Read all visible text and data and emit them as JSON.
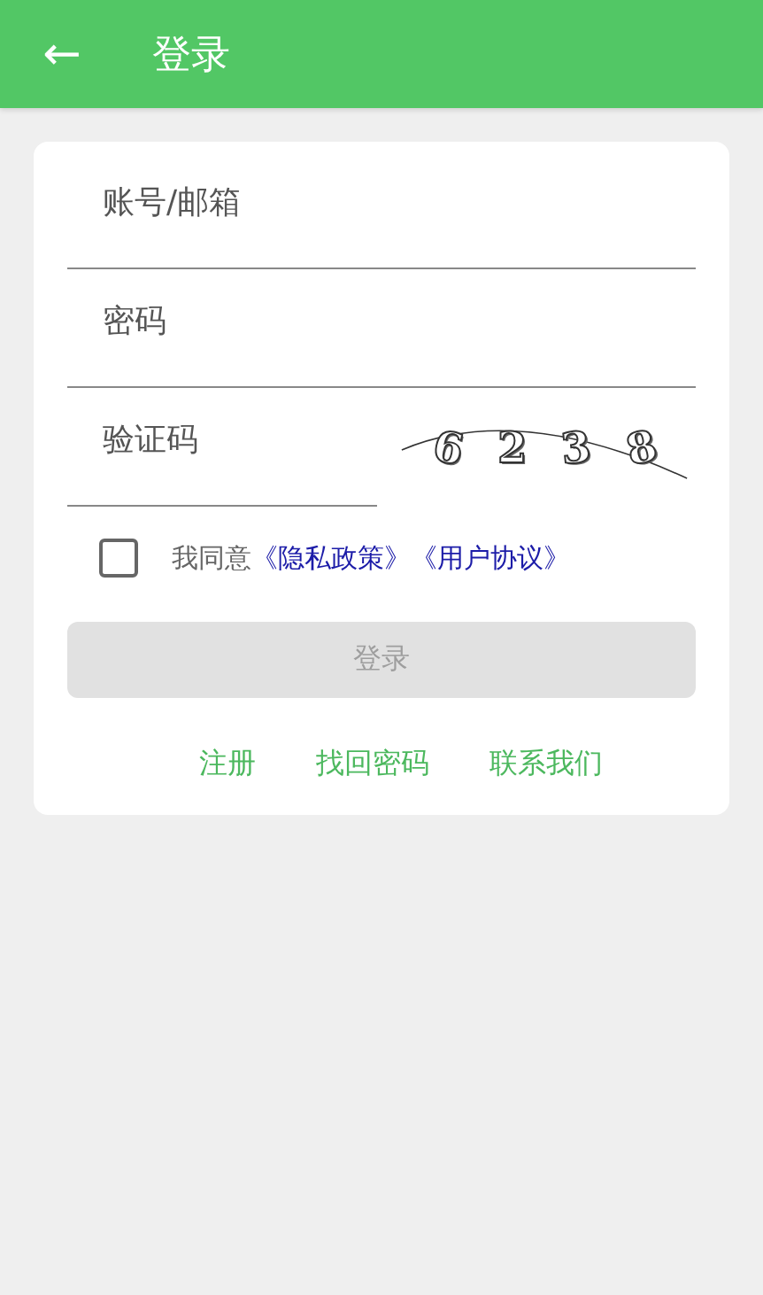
{
  "header": {
    "back_icon": "←",
    "title": "登录"
  },
  "fields": [
    {
      "kind": "text",
      "placeholder": "账号/邮箱"
    },
    {
      "kind": "text",
      "placeholder": "密码"
    },
    {
      "kind": "captcha",
      "placeholder": "验证码",
      "captcha": [
        "6",
        "2",
        "3",
        "8"
      ]
    }
  ],
  "agreement": {
    "checked": false,
    "text": "我同意",
    "links": [
      "《隐私政策》",
      "《用户协议》"
    ]
  },
  "login_button": {
    "label": "登录",
    "disabled": true
  },
  "links": [
    "注册",
    "找回密码",
    "联系我们"
  ]
}
